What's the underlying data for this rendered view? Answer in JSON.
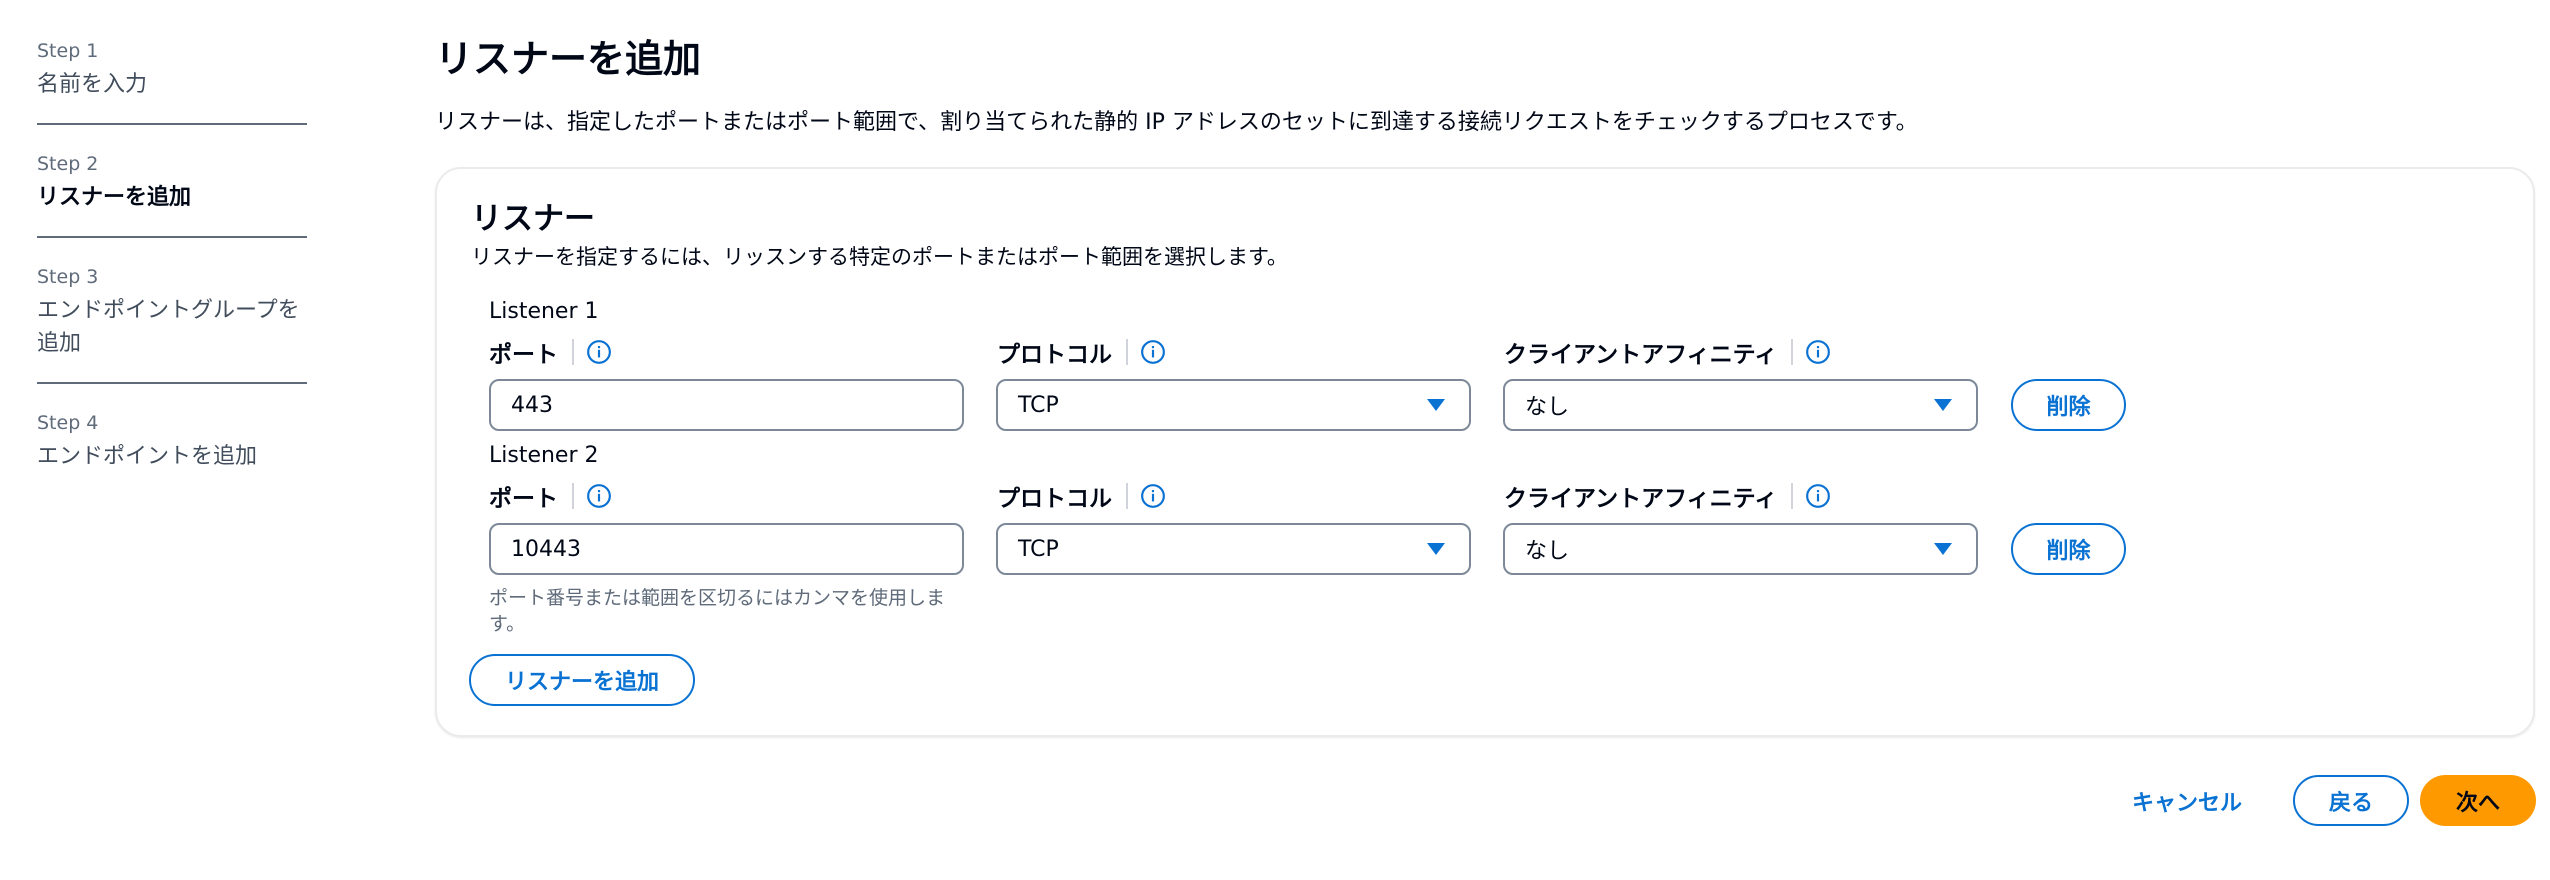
{
  "sidebar": {
    "steps": [
      {
        "num": "Step 1",
        "label": "名前を入力"
      },
      {
        "num": "Step 2",
        "label": "リスナーを追加"
      },
      {
        "num": "Step 3",
        "label": "エンドポイントグループを追加"
      },
      {
        "num": "Step 4",
        "label": "エンドポイントを追加"
      }
    ]
  },
  "page": {
    "title": "リスナーを追加",
    "description": "リスナーは、指定したポートまたはポート範囲で、割り当てられた静的 IP アドレスのセットに到達する接続リクエストをチェックするプロセスです。"
  },
  "panel": {
    "title": "リスナー",
    "description": "リスナーを指定するには、リッスンする特定のポートまたはポート範囲を選択します。",
    "port_label": "ポート",
    "protocol_label": "プロトコル",
    "affinity_label": "クライアントアフィニティ",
    "listeners": [
      {
        "title": "Listener 1",
        "port": "443",
        "protocol": "TCP",
        "affinity": "なし",
        "remove_label": "削除"
      },
      {
        "title": "Listener 2",
        "port": "10443",
        "protocol": "TCP",
        "affinity": "なし",
        "remove_label": "削除"
      }
    ],
    "port_hint": "ポート番号または範囲を区切るにはカンマを使用します。",
    "add_listener_label": "リスナーを追加"
  },
  "footer": {
    "cancel_label": "キャンセル",
    "back_label": "戻る",
    "next_label": "次へ"
  },
  "colors": {
    "accent": "#0972d3",
    "primary_button": "#ff9900"
  },
  "icons": [
    "info-icon",
    "caret-down-icon"
  ]
}
